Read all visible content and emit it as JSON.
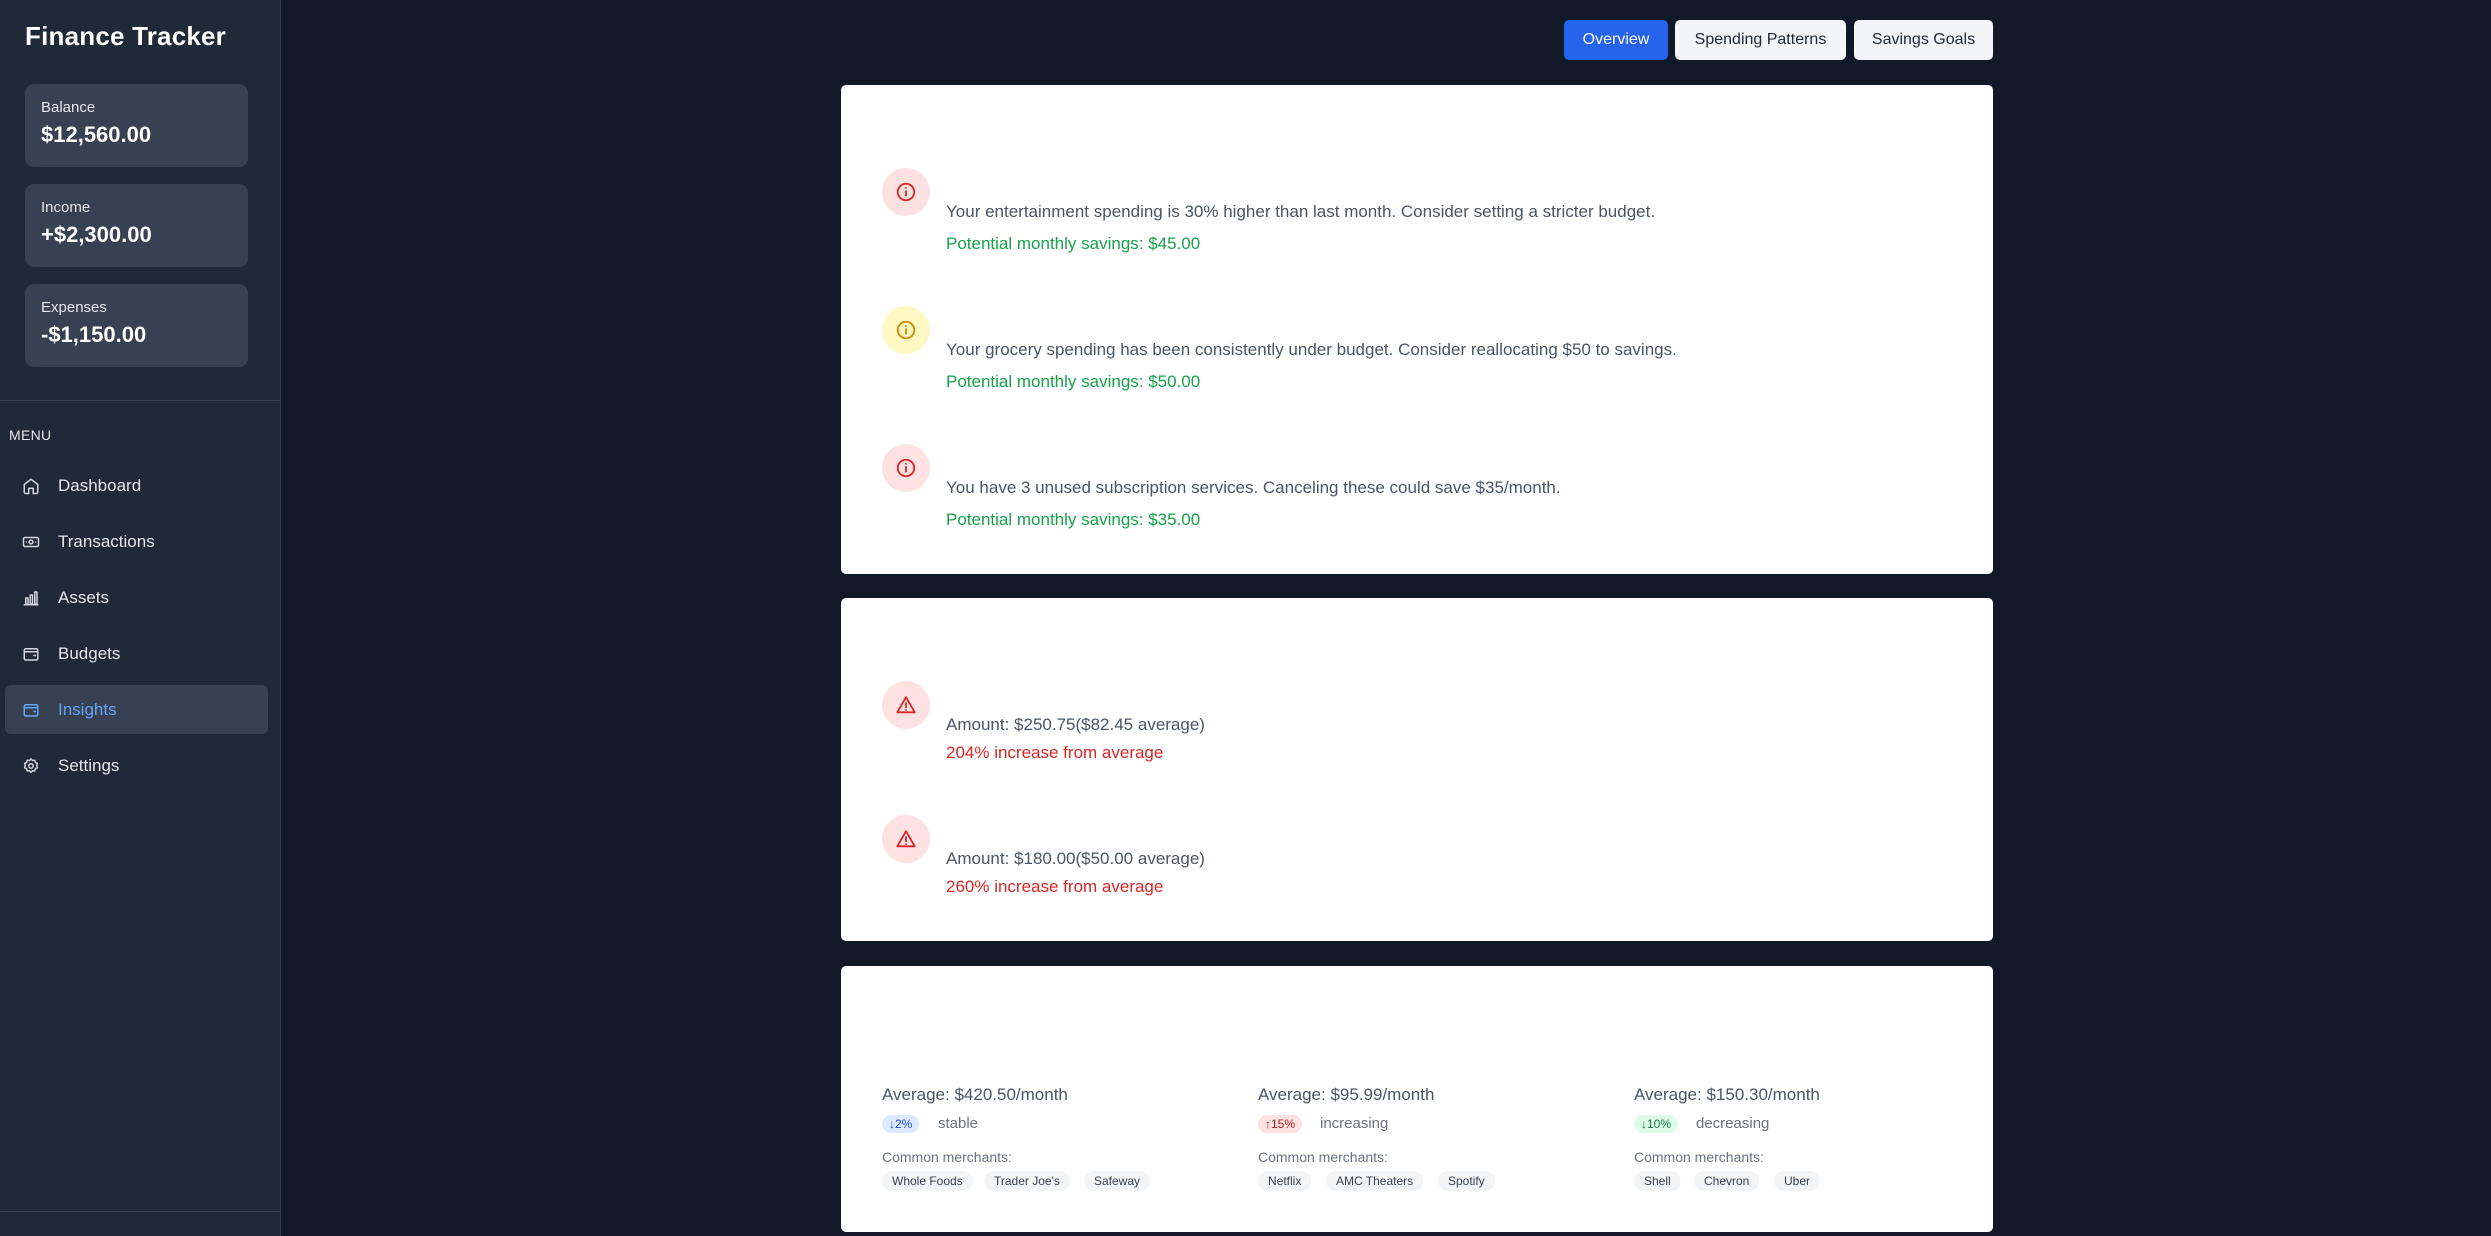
{
  "app": {
    "title": "Finance Tracker"
  },
  "stats": [
    {
      "label": "Balance",
      "value": "$12,560.00"
    },
    {
      "label": "Income",
      "value": "+$2,300.00"
    },
    {
      "label": "Expenses",
      "value": "-$1,150.00"
    }
  ],
  "menu": {
    "heading": "MENU",
    "items": [
      {
        "label": "Dashboard",
        "icon": "home-icon"
      },
      {
        "label": "Transactions",
        "icon": "banknote-icon"
      },
      {
        "label": "Assets",
        "icon": "bar-chart-icon"
      },
      {
        "label": "Budgets",
        "icon": "wallet-icon"
      },
      {
        "label": "Insights",
        "icon": "wallet-icon",
        "active": true
      },
      {
        "label": "Settings",
        "icon": "gear-icon"
      }
    ]
  },
  "tabs": [
    {
      "label": "Overview",
      "active": true
    },
    {
      "label": "Spending Patterns"
    },
    {
      "label": "Savings Goals"
    }
  ],
  "recommendations": [
    {
      "severity": "high",
      "text": "Your entertainment spending is 30% higher than last month. Consider setting a stricter budget.",
      "savings": "Potential monthly savings: $45.00"
    },
    {
      "severity": "medium",
      "text": "Your grocery spending has been consistently under budget. Consider reallocating $50 to savings.",
      "savings": "Potential monthly savings: $50.00"
    },
    {
      "severity": "high",
      "text": "You have 3 unused subscription services. Canceling these could save $35/month.",
      "savings": "Potential monthly savings: $35.00"
    }
  ],
  "anomalies": [
    {
      "amount": "Amount: $250.75($82.45 average)",
      "increase": "204% increase from average"
    },
    {
      "amount": "Amount: $180.00($50.00 average)",
      "increase": "260% increase from average"
    }
  ],
  "patterns": [
    {
      "average": "Average: $420.50/month",
      "change": "↓2%",
      "trend": "stable",
      "merchants_label": "Common merchants:",
      "merchants": [
        "Whole Foods",
        "Trader Joe's",
        "Safeway"
      ]
    },
    {
      "average": "Average: $95.99/month",
      "change": "↑15%",
      "trend": "increasing",
      "merchants_label": "Common merchants:",
      "merchants": [
        "Netflix",
        "AMC Theaters",
        "Spotify"
      ]
    },
    {
      "average": "Average: $150.30/month",
      "change": "↓10%",
      "trend": "decreasing",
      "merchants_label": "Common merchants:",
      "merchants": [
        "Shell",
        "Chevron",
        "Uber"
      ]
    }
  ],
  "colors": {
    "accent": "#2563eb",
    "sidebar_bg": "#1f2937",
    "page_bg": "#111827",
    "savings_green": "#16a34a",
    "alert_red": "#dc2626"
  }
}
